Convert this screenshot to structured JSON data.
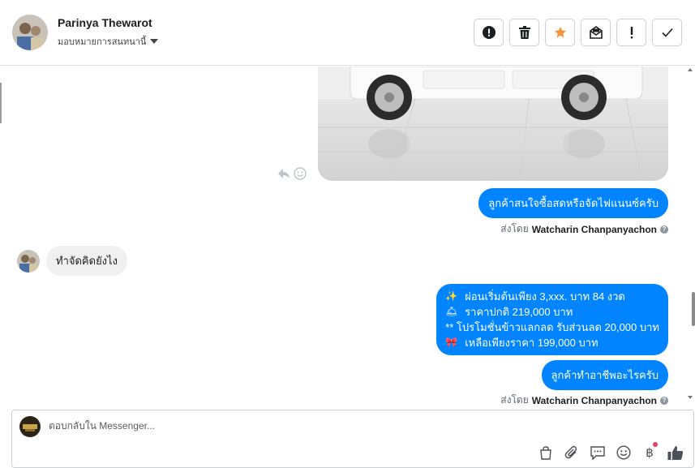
{
  "header": {
    "contact_name": "Parinya Thewarot",
    "assign_label": "มอบหมายการสนทนานี้",
    "actions": [
      {
        "name": "report-spam-button",
        "icon": "alert-circle-icon"
      },
      {
        "name": "delete-button",
        "icon": "trash-icon"
      },
      {
        "name": "star-button",
        "icon": "star-icon"
      },
      {
        "name": "mark-unread-button",
        "icon": "envelope-icon"
      },
      {
        "name": "follow-up-button",
        "icon": "exclamation-icon"
      },
      {
        "name": "mark-done-button",
        "icon": "check-icon"
      }
    ],
    "accent_star": "#f5943a"
  },
  "conversation": {
    "msg1": "ลูกค้าสนใจซื้อสดหรือจัดไฟแนนซ์ครับ",
    "sent_by_label": "ส่งโดย",
    "agent_name": "Watcharin Chanpanyachon",
    "incoming": "ทำจัดคิดยังไง",
    "promo": {
      "line1_emoji": "✨",
      "line1": "ผ่อนเริ่มต้นเพียง 3,xxx. บาท 84 งวด",
      "line2_emoji": "🛎",
      "line2": "ราคาปกติ 219,000 บาท",
      "line3": "** โปรโมชั่นข้าวแลกลด รับส่วนลด 20,000 บาท",
      "line4_emoji": "🎀",
      "line4": "เหลือเพียงราคา 199,000 บาท"
    },
    "msg3": "ลูกค้าทำอาชีพอะไรครับ",
    "bubble_color": "#0084ff"
  },
  "composer": {
    "placeholder": "ตอบกลับใน Messenger...",
    "tools": [
      "shopping-bag-icon",
      "paperclip-icon",
      "saved-replies-icon",
      "emoji-icon",
      "baht-icon",
      "like-icon"
    ]
  }
}
